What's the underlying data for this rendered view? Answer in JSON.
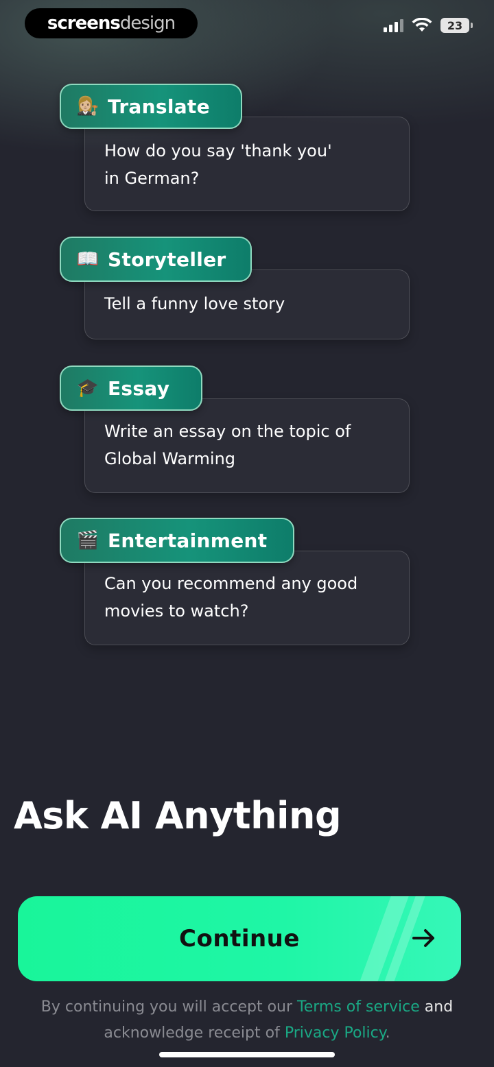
{
  "status_bar": {
    "brand_part1": "screens",
    "brand_part2": "design",
    "battery": "23"
  },
  "cards": [
    {
      "emoji": "👩🏼‍⚖️",
      "emoji_name": "judge-emoji",
      "tag": "Translate",
      "text_line1": "How do you say 'thank you'",
      "text_line2": "in German?"
    },
    {
      "emoji": "📖",
      "emoji_name": "book-emoji",
      "tag": "Storyteller",
      "text_line1": "Tell a funny love story",
      "text_line2": ""
    },
    {
      "emoji": "🎓",
      "emoji_name": "graduation-cap-emoji",
      "tag": "Essay",
      "text_line1": "Write an essay on the topic of",
      "text_line2": "Global Warming"
    },
    {
      "emoji": "🎬",
      "emoji_name": "clapper-board-emoji",
      "tag": "Entertainment",
      "text_line1": "Can you recommend any good",
      "text_line2": "movies to watch?"
    }
  ],
  "headline": "Ask AI Anything",
  "continue_label": "Continue",
  "legal": {
    "part1": "By continuing you will accept our ",
    "terms": "Terms of service",
    "part2": " and",
    "part3": "acknowledge receipt of ",
    "privacy": "Privacy Policy",
    "part4": "."
  },
  "colors": {
    "background": "#24252f",
    "accent_green": "#1ff6a6",
    "tag_teal": "#16937a",
    "link_green": "#1aa985"
  }
}
